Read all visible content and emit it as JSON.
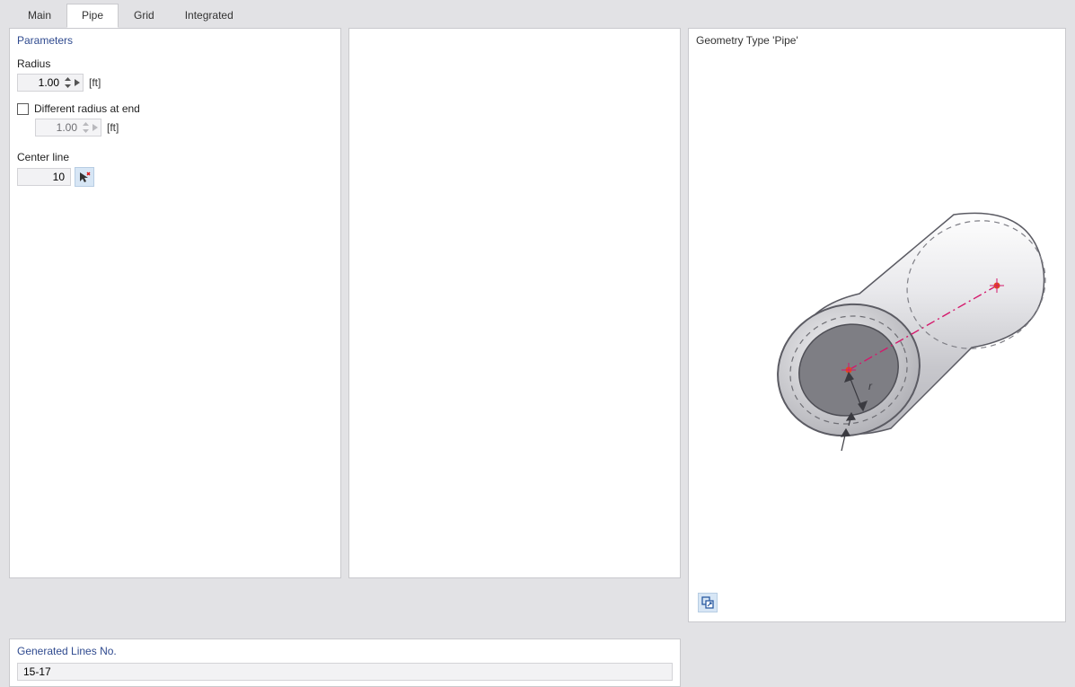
{
  "tabs": {
    "main": "Main",
    "pipe": "Pipe",
    "grid": "Grid",
    "integrated": "Integrated",
    "active": "pipe"
  },
  "parameters": {
    "title": "Parameters",
    "radius_label": "Radius",
    "radius_value": "1.00",
    "radius_unit": "[ft]",
    "diff_radius_label": "Different radius at end",
    "diff_radius_checked": false,
    "radius_end_value": "1.00",
    "radius_end_unit": "[ft]",
    "center_line_label": "Center line",
    "center_line_value": "10"
  },
  "generated": {
    "title": "Generated Lines No.",
    "value": "15-17"
  },
  "preview": {
    "title": "Geometry Type 'Pipe'",
    "radius_symbol": "r"
  }
}
